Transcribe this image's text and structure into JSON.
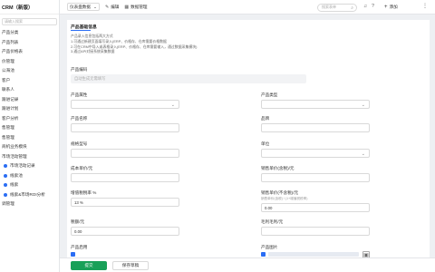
{
  "sidebar": {
    "brand": "CRM（新版）",
    "search_placeholder": "请输入搜索",
    "items": [
      {
        "label": "产品分类"
      },
      {
        "label": "产品列表"
      },
      {
        "label": "产品价格表"
      },
      {
        "label": "价管理"
      },
      {
        "label": "公海池"
      },
      {
        "label": "客户"
      },
      {
        "label": "联系人"
      },
      {
        "label": "跟进记录"
      },
      {
        "label": "跟进计划"
      },
      {
        "label": "客户分析"
      },
      {
        "label": "售管理"
      },
      {
        "label": "售管理"
      },
      {
        "label": "商机业务模块"
      },
      {
        "label": "市场活动管理"
      },
      {
        "label": "市场活动记录"
      },
      {
        "label": "线索池"
      },
      {
        "label": "线索"
      },
      {
        "label": "线索&市场ROI分析"
      },
      {
        "label": "调管理"
      }
    ]
  },
  "topbar": {
    "workspace": "仪表盘数据",
    "edit_label": "编辑",
    "data_manage_label": "数据管理",
    "search_placeholder": "搜索表单",
    "add_label": "添加"
  },
  "form": {
    "section_title": "产品基础信息",
    "tips": [
      "产品录入信息包括两大方式",
      "1.可通过新建页面填写录入(ERP、价格存、仓库需要价格数据",
      "2.可在CRM中导入或表格录入(ERP、价格存、仓库需要输入，通过数据采集模块)",
      "3.通过API对接系统采集数据"
    ],
    "fields": {
      "code": {
        "label": "产品编码",
        "placeholder": "自动生成无需填写"
      },
      "brand": {
        "label": "产品属性"
      },
      "category": {
        "label": "产品类型"
      },
      "name": {
        "label": "产品名称"
      },
      "spec": {
        "label": "品牌"
      },
      "model": {
        "label": "规格型号"
      },
      "unit": {
        "label": "单位"
      },
      "cost": {
        "label": "成本单价/元"
      },
      "sale_price": {
        "label": "销售单价(含税)/元"
      },
      "tax_rate": {
        "label": "增值税税率 %",
        "value": "13 %"
      },
      "sale_price_ex": {
        "label": "销售单价(不含税)/元",
        "hint": "销售单价(含税) / (1+增值税税率)",
        "value": "0.00"
      },
      "tax_amount": {
        "label": "税额/元",
        "value": "0.00"
      },
      "gross_profit": {
        "label": "毛利毛利/元"
      },
      "status": {
        "label": "产品启用"
      },
      "image": {
        "label": "产品图片"
      }
    }
  },
  "footer": {
    "submit_label": "提交",
    "save_draft_label": "保存草稿"
  },
  "colors": {
    "accent": "#2a6df4",
    "primary_button": "#18a058"
  }
}
